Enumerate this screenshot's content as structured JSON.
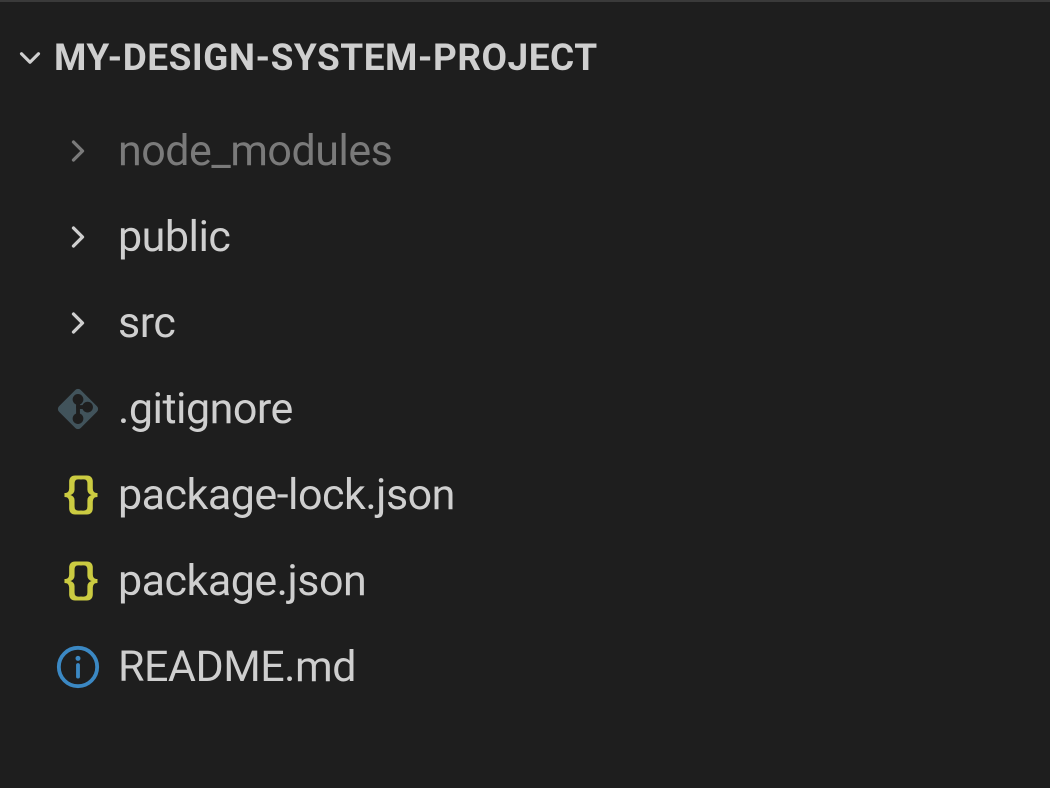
{
  "project": {
    "name": "MY-DESIGN-SYSTEM-PROJECT",
    "expanded": true
  },
  "items": [
    {
      "type": "folder",
      "label": "node_modules",
      "dim": true,
      "icon": "chevron-right"
    },
    {
      "type": "folder",
      "label": "public",
      "dim": false,
      "icon": "chevron-right"
    },
    {
      "type": "folder",
      "label": "src",
      "dim": false,
      "icon": "chevron-right"
    },
    {
      "type": "file",
      "label": ".gitignore",
      "dim": false,
      "icon": "git"
    },
    {
      "type": "file",
      "label": "package-lock.json",
      "dim": false,
      "icon": "json"
    },
    {
      "type": "file",
      "label": "package.json",
      "dim": false,
      "icon": "json"
    },
    {
      "type": "file",
      "label": "README.md",
      "dim": false,
      "icon": "info"
    }
  ],
  "colors": {
    "background": "#1e1e1e",
    "text": "#cfcfcf",
    "dim_text": "#7a7a7a",
    "json_icon": "#cbcb41",
    "git_icon": "#41535b",
    "info_icon": "#3b88c3"
  }
}
